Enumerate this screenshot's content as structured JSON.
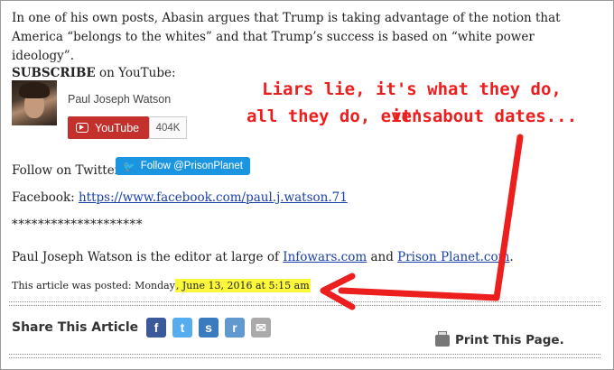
{
  "article": {
    "intro": "In one of his own posts, Abasin argues that Trump is taking advantage of the notion that America “belongs to the whites” and that Trump’s success is based on “white power ideology”.",
    "subscribe_bold": "SUBSCRIBE",
    "subscribe_rest": " on YouTube:",
    "channel_name": "Paul Joseph Watson",
    "youtube_label": "YouTube",
    "youtube_count": "404K",
    "twitter_prefix": "Follow on Twitter:",
    "twitter_button": "Follow @PrisonPlanet",
    "facebook_prefix": "Facebook: ",
    "facebook_url": "https://www.facebook.com/paul.j.watson.71",
    "stars": "********************",
    "editor_prefix": "Paul Joseph Watson is the editor at large of ",
    "editor_link1": "Infowars.com",
    "editor_mid": " and ",
    "editor_link2": "Prison Planet.com",
    "editor_end": ".",
    "posted_prefix": "This article was posted: Monday",
    "posted_highlight": ", June 13, 2016 at 5:15 am"
  },
  "share": {
    "label": "Share This Article",
    "icons": [
      {
        "name": "facebook-icon",
        "glyph": "f",
        "color": "#3b5998"
      },
      {
        "name": "twitter-icon",
        "glyph": "t",
        "color": "#55acee"
      },
      {
        "name": "stumbleupon-icon",
        "glyph": "s",
        "color": "#3a7bbf"
      },
      {
        "name": "reddit-icon",
        "glyph": "r",
        "color": "#5f99cf"
      },
      {
        "name": "email-icon",
        "glyph": "✉",
        "color": "#aaaaaa"
      }
    ],
    "print_label": "Print This Page."
  },
  "annotation": {
    "line1": "Liars lie, it's what they do, it's",
    "line2": "all they do, even about dates...",
    "color": "#ec1e1e"
  }
}
